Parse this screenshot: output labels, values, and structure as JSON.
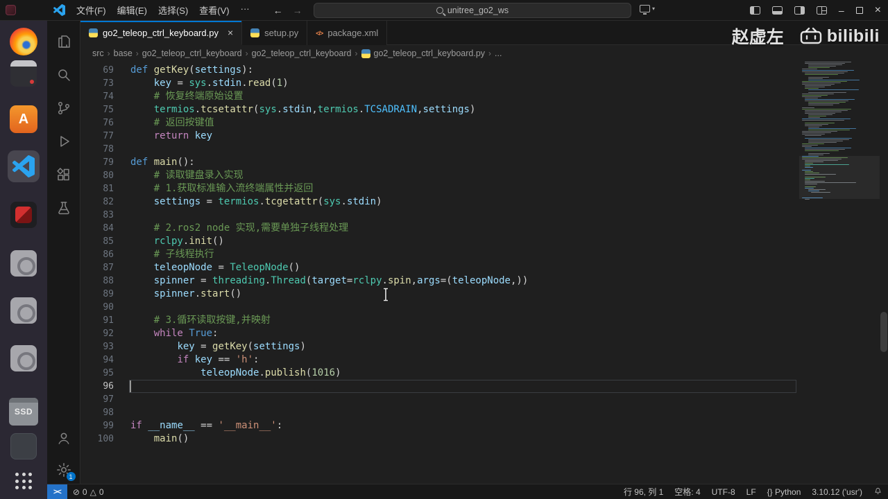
{
  "colors": {
    "accent": "#0078d4",
    "editor_bg": "#1f1f1f",
    "ui_bg": "#181818",
    "remote_bg": "#2472c8",
    "token_keyword": "#569CD6",
    "token_flow": "#C586C0",
    "token_function": "#DCDCAA",
    "token_variable": "#9CDCFE",
    "token_module": "#4EC9B0",
    "token_string": "#CE9178",
    "token_number": "#B5CEA8",
    "token_comment": "#6A9955"
  },
  "titlebar": {
    "menus": [
      {
        "label": "文件(F)"
      },
      {
        "label": "编辑(E)"
      },
      {
        "label": "选择(S)"
      },
      {
        "label": "查看(V)"
      },
      {
        "label": "···"
      }
    ],
    "nav_back": "←",
    "nav_forward": "→",
    "search": "unitree_go2_ws",
    "controls": {
      "minimize": "–",
      "close": "×"
    }
  },
  "tabs": [
    {
      "label": "go2_teleop_ctrl_keyboard.py",
      "icon": "python",
      "active": true,
      "close": "×"
    },
    {
      "label": "setup.py",
      "icon": "python",
      "active": false
    },
    {
      "label": "package.xml",
      "icon": "xml",
      "active": false
    }
  ],
  "breadcrumbs": [
    {
      "label": "src"
    },
    {
      "label": "base"
    },
    {
      "label": "go2_teleop_ctrl_keyboard"
    },
    {
      "label": "go2_teleop_ctrl_keyboard"
    },
    {
      "label": "go2_teleop_ctrl_keyboard.py",
      "icon": "python"
    },
    {
      "label": "..."
    }
  ],
  "watermark": {
    "author": "赵虚左",
    "brand": "bilibili"
  },
  "dock": {
    "items": [
      {
        "name": "firefox-icon"
      },
      {
        "name": "terminal-app-icon"
      },
      {
        "name": "software-center-icon"
      },
      {
        "name": "vscode-icon",
        "active": true
      },
      {
        "name": "recorder-app-icon"
      },
      {
        "name": "gray-app-icon"
      },
      {
        "name": "gray-app-icon-2"
      },
      {
        "name": "gray-app-icon-3"
      },
      {
        "name": "ssd-drive-icon",
        "label": "SSD"
      },
      {
        "name": "dark-app-icon"
      },
      {
        "name": "show-apps-icon"
      }
    ]
  },
  "activity": {
    "top": [
      {
        "icon": "files-icon"
      },
      {
        "icon": "search-icon"
      },
      {
        "icon": "source-control-icon"
      },
      {
        "icon": "run-debug-icon"
      },
      {
        "icon": "extensions-icon"
      },
      {
        "icon": "testing-icon"
      }
    ],
    "bottom": [
      {
        "icon": "account-icon"
      },
      {
        "icon": "settings-gear-icon",
        "badge": "1"
      }
    ]
  },
  "code": {
    "total_lines": 100,
    "lines": [
      {
        "num": 69,
        "tokens": [
          [
            "kw",
            "def "
          ],
          [
            "fn",
            "getKey"
          ],
          [
            "pn",
            "("
          ],
          [
            "var",
            "settings"
          ],
          [
            "pn",
            "):"
          ]
        ]
      },
      {
        "num": 73,
        "tokens": [
          [
            "pn",
            "    "
          ],
          [
            "var",
            "key"
          ],
          [
            "pn",
            " = "
          ],
          [
            "mod",
            "sys"
          ],
          [
            "pn",
            "."
          ],
          [
            "var",
            "stdin"
          ],
          [
            "pn",
            "."
          ],
          [
            "fn",
            "read"
          ],
          [
            "pn",
            "("
          ],
          [
            "num",
            "1"
          ],
          [
            "pn",
            ")"
          ]
        ]
      },
      {
        "num": 74,
        "tokens": [
          [
            "pn",
            "    "
          ],
          [
            "com",
            "# 恢复终端原始设置"
          ]
        ]
      },
      {
        "num": 75,
        "tokens": [
          [
            "pn",
            "    "
          ],
          [
            "mod",
            "termios"
          ],
          [
            "pn",
            "."
          ],
          [
            "fn",
            "tcsetattr"
          ],
          [
            "pn",
            "("
          ],
          [
            "mod",
            "sys"
          ],
          [
            "pn",
            "."
          ],
          [
            "var",
            "stdin"
          ],
          [
            "pn",
            ","
          ],
          [
            "mod",
            "termios"
          ],
          [
            "pn",
            "."
          ],
          [
            "const",
            "TCSADRAIN"
          ],
          [
            "pn",
            ","
          ],
          [
            "var",
            "settings"
          ],
          [
            "pn",
            ")"
          ]
        ]
      },
      {
        "num": 76,
        "tokens": [
          [
            "pn",
            "    "
          ],
          [
            "com",
            "# 返回按键值"
          ]
        ]
      },
      {
        "num": 77,
        "tokens": [
          [
            "pn",
            "    "
          ],
          [
            "ctrl",
            "return"
          ],
          [
            "pn",
            " "
          ],
          [
            "var",
            "key"
          ]
        ]
      },
      {
        "num": 78,
        "tokens": []
      },
      {
        "num": 79,
        "tokens": [
          [
            "kw",
            "def "
          ],
          [
            "fn",
            "main"
          ],
          [
            "pn",
            "():"
          ]
        ]
      },
      {
        "num": 80,
        "tokens": [
          [
            "pn",
            "    "
          ],
          [
            "com",
            "# 读取键盘录入实现"
          ]
        ]
      },
      {
        "num": 81,
        "tokens": [
          [
            "pn",
            "    "
          ],
          [
            "com",
            "# 1.获取标准输入流终端属性并返回"
          ]
        ]
      },
      {
        "num": 82,
        "tokens": [
          [
            "pn",
            "    "
          ],
          [
            "var",
            "settings"
          ],
          [
            "pn",
            " = "
          ],
          [
            "mod",
            "termios"
          ],
          [
            "pn",
            "."
          ],
          [
            "fn",
            "tcgetattr"
          ],
          [
            "pn",
            "("
          ],
          [
            "mod",
            "sys"
          ],
          [
            "pn",
            "."
          ],
          [
            "var",
            "stdin"
          ],
          [
            "pn",
            ")"
          ]
        ]
      },
      {
        "num": 83,
        "tokens": []
      },
      {
        "num": 84,
        "tokens": [
          [
            "pn",
            "    "
          ],
          [
            "com",
            "# 2.ros2 node 实现,需要单独子线程处理"
          ]
        ]
      },
      {
        "num": 85,
        "tokens": [
          [
            "pn",
            "    "
          ],
          [
            "mod",
            "rclpy"
          ],
          [
            "pn",
            "."
          ],
          [
            "fn",
            "init"
          ],
          [
            "pn",
            "()"
          ]
        ]
      },
      {
        "num": 86,
        "tokens": [
          [
            "pn",
            "    "
          ],
          [
            "com",
            "# 子线程执行"
          ]
        ]
      },
      {
        "num": 87,
        "tokens": [
          [
            "pn",
            "    "
          ],
          [
            "var",
            "teleopNode"
          ],
          [
            "pn",
            " = "
          ],
          [
            "cls",
            "TeleopNode"
          ],
          [
            "pn",
            "()"
          ]
        ]
      },
      {
        "num": 88,
        "tokens": [
          [
            "pn",
            "    "
          ],
          [
            "var",
            "spinner"
          ],
          [
            "pn",
            " = "
          ],
          [
            "mod",
            "threading"
          ],
          [
            "pn",
            "."
          ],
          [
            "cls",
            "Thread"
          ],
          [
            "pn",
            "("
          ],
          [
            "var",
            "target"
          ],
          [
            "pn",
            "="
          ],
          [
            "mod",
            "rclpy"
          ],
          [
            "pn",
            "."
          ],
          [
            "fn",
            "spin"
          ],
          [
            "pn",
            ","
          ],
          [
            "var",
            "args"
          ],
          [
            "pn",
            "=("
          ],
          [
            "var",
            "teleopNode"
          ],
          [
            "pn",
            ",))"
          ]
        ]
      },
      {
        "num": 89,
        "tokens": [
          [
            "pn",
            "    "
          ],
          [
            "var",
            "spinner"
          ],
          [
            "pn",
            "."
          ],
          [
            "fn",
            "start"
          ],
          [
            "pn",
            "()"
          ]
        ]
      },
      {
        "num": 90,
        "tokens": []
      },
      {
        "num": 91,
        "tokens": [
          [
            "pn",
            "    "
          ],
          [
            "com",
            "# 3.循环读取按键,并映射"
          ]
        ]
      },
      {
        "num": 92,
        "tokens": [
          [
            "pn",
            "    "
          ],
          [
            "ctrl",
            "while"
          ],
          [
            "pn",
            " "
          ],
          [
            "kw",
            "True"
          ],
          [
            "pn",
            ":"
          ]
        ]
      },
      {
        "num": 93,
        "tokens": [
          [
            "pn",
            "        "
          ],
          [
            "var",
            "key"
          ],
          [
            "pn",
            " = "
          ],
          [
            "fn",
            "getKey"
          ],
          [
            "pn",
            "("
          ],
          [
            "var",
            "settings"
          ],
          [
            "pn",
            ")"
          ]
        ]
      },
      {
        "num": 94,
        "tokens": [
          [
            "pn",
            "        "
          ],
          [
            "ctrl",
            "if"
          ],
          [
            "pn",
            " "
          ],
          [
            "var",
            "key"
          ],
          [
            "pn",
            " == "
          ],
          [
            "str",
            "'h'"
          ],
          [
            "pn",
            ":"
          ]
        ]
      },
      {
        "num": 95,
        "tokens": [
          [
            "pn",
            "            "
          ],
          [
            "var",
            "teleopNode"
          ],
          [
            "pn",
            "."
          ],
          [
            "fn",
            "publish"
          ],
          [
            "pn",
            "("
          ],
          [
            "num",
            "1016"
          ],
          [
            "pn",
            ")"
          ]
        ]
      },
      {
        "num": 96,
        "tokens": [],
        "current": true
      },
      {
        "num": 97,
        "tokens": []
      },
      {
        "num": 98,
        "tokens": []
      },
      {
        "num": 99,
        "tokens": [
          [
            "ctrl",
            "if"
          ],
          [
            "pn",
            " "
          ],
          [
            "var",
            "__name__"
          ],
          [
            "pn",
            " == "
          ],
          [
            "str",
            "'__main__'"
          ],
          [
            "pn",
            ":"
          ]
        ]
      },
      {
        "num": 100,
        "tokens": [
          [
            "pn",
            "    "
          ],
          [
            "fn",
            "main"
          ],
          [
            "pn",
            "()"
          ]
        ]
      }
    ]
  },
  "statusbar": {
    "remote": "><",
    "errors": "0",
    "warnings": "0",
    "items": [
      "行 96, 列 1",
      "空格: 4",
      "UTF-8",
      "LF",
      "{} Python",
      "3.10.12 ('usr')"
    ]
  }
}
